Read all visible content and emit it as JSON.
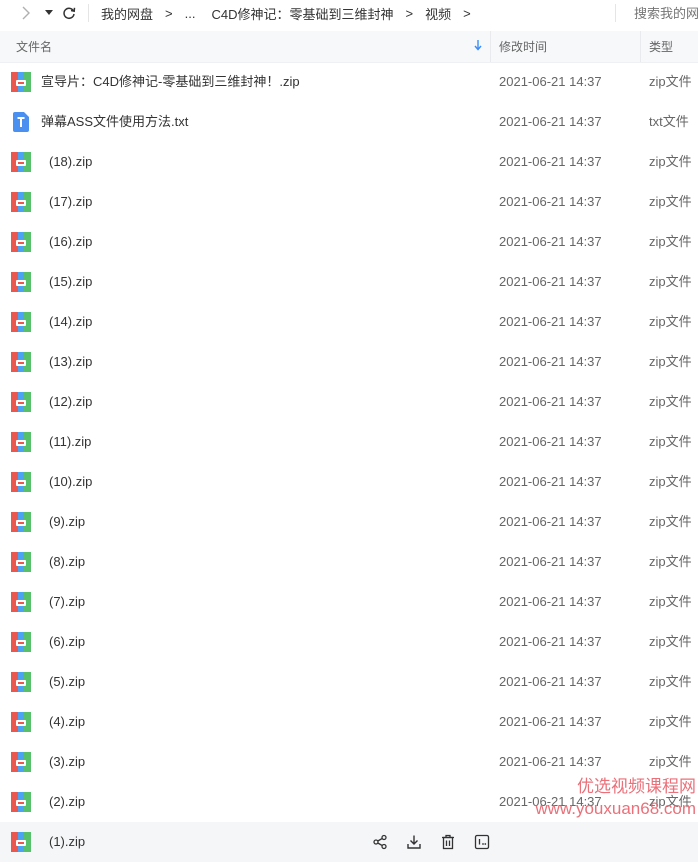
{
  "toolbar": {
    "forward_icon": "chevron-right-icon",
    "dropdown_icon": "caret-down-icon",
    "refresh_icon": "refresh-icon",
    "breadcrumbs": [
      "我的网盘",
      "...",
      "C4D修神记：零基础到三维封神",
      "视频"
    ],
    "crumb_separator": ">",
    "search_placeholder": "搜索我的网盘"
  },
  "columns": {
    "name": "文件名",
    "time": "修改时间",
    "type": "类型",
    "sort_icon": "arrow-down-icon"
  },
  "files": [
    {
      "name": "宣导片：C4D修神记-零基础到三维封神！.zip",
      "time": "2021-06-21 14:37",
      "type": "zip文件",
      "icon": "zip-archive-icon"
    },
    {
      "name": "弹幕ASS文件使用方法.txt",
      "time": "2021-06-21 14:37",
      "type": "txt文件",
      "icon": "text-file-icon"
    },
    {
      "name": "(18).zip",
      "time": "2021-06-21 14:37",
      "type": "zip文件",
      "icon": "zip-archive-icon"
    },
    {
      "name": "(17).zip",
      "time": "2021-06-21 14:37",
      "type": "zip文件",
      "icon": "zip-archive-icon"
    },
    {
      "name": "(16).zip",
      "time": "2021-06-21 14:37",
      "type": "zip文件",
      "icon": "zip-archive-icon"
    },
    {
      "name": "(15).zip",
      "time": "2021-06-21 14:37",
      "type": "zip文件",
      "icon": "zip-archive-icon"
    },
    {
      "name": "(14).zip",
      "time": "2021-06-21 14:37",
      "type": "zip文件",
      "icon": "zip-archive-icon"
    },
    {
      "name": "(13).zip",
      "time": "2021-06-21 14:37",
      "type": "zip文件",
      "icon": "zip-archive-icon"
    },
    {
      "name": "(12).zip",
      "time": "2021-06-21 14:37",
      "type": "zip文件",
      "icon": "zip-archive-icon"
    },
    {
      "name": "(11).zip",
      "time": "2021-06-21 14:37",
      "type": "zip文件",
      "icon": "zip-archive-icon"
    },
    {
      "name": "(10).zip",
      "time": "2021-06-21 14:37",
      "type": "zip文件",
      "icon": "zip-archive-icon"
    },
    {
      "name": "(9).zip",
      "time": "2021-06-21 14:37",
      "type": "zip文件",
      "icon": "zip-archive-icon"
    },
    {
      "name": "(8).zip",
      "time": "2021-06-21 14:37",
      "type": "zip文件",
      "icon": "zip-archive-icon"
    },
    {
      "name": "(7).zip",
      "time": "2021-06-21 14:37",
      "type": "zip文件",
      "icon": "zip-archive-icon"
    },
    {
      "name": "(6).zip",
      "time": "2021-06-21 14:37",
      "type": "zip文件",
      "icon": "zip-archive-icon"
    },
    {
      "name": "(5).zip",
      "time": "2021-06-21 14:37",
      "type": "zip文件",
      "icon": "zip-archive-icon"
    },
    {
      "name": "(4).zip",
      "time": "2021-06-21 14:37",
      "type": "zip文件",
      "icon": "zip-archive-icon"
    },
    {
      "name": "(3).zip",
      "time": "2021-06-21 14:37",
      "type": "zip文件",
      "icon": "zip-archive-icon"
    },
    {
      "name": "(2).zip",
      "time": "2021-06-21 14:37",
      "type": "zip文件",
      "icon": "zip-archive-icon"
    },
    {
      "name": "(1).zip",
      "time": "",
      "type": "",
      "icon": "zip-archive-icon"
    }
  ],
  "hover_row_actions": [
    "share-icon",
    "download-icon",
    "delete-icon",
    "more-icon"
  ],
  "watermark": {
    "line1": "优选视频课程网",
    "line2": "www.youxuan68.com"
  },
  "colors": {
    "accent": "#3a8df8",
    "header_bg": "#f7f8fa",
    "hover_row_bg": "#f5f6f8",
    "watermark": "#e8616b"
  }
}
